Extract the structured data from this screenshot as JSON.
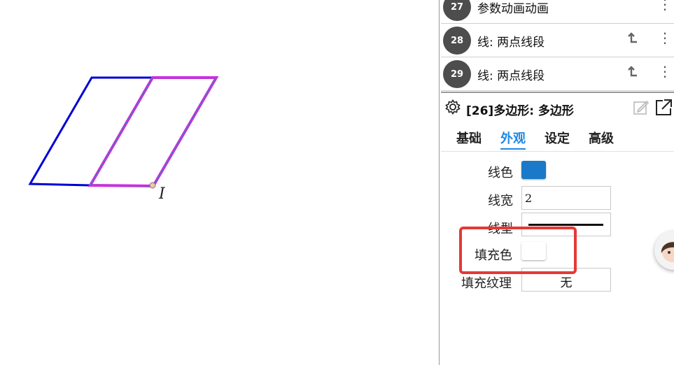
{
  "canvas": {
    "point_label": "I"
  },
  "object_list": [
    {
      "number": "27",
      "label": "参数动画动画",
      "has_redefine": false,
      "more": "⋮"
    },
    {
      "number": "28",
      "label": "线: 两点线段",
      "has_redefine": true,
      "more": "⋮"
    },
    {
      "number": "29",
      "label": "线: 两点线段",
      "has_redefine": true,
      "more": "⋮"
    }
  ],
  "properties": {
    "title": "[26]多边形: 多边形",
    "tabs": [
      "基础",
      "外观",
      "设定",
      "高级"
    ],
    "active_tab": "外观",
    "line_color_label": "线色",
    "line_color": "#1a79c8",
    "line_width_label": "线宽",
    "line_width_value": "2",
    "line_style_label": "线型",
    "fill_color_label": "填充色",
    "fill_color": "#ffffff",
    "fill_texture_label": "填充纹理",
    "fill_texture_value": "无"
  },
  "colors": {
    "polygon_blue": "#0000d6",
    "segment_magenta": "#e020e0",
    "accent": "#1e88e5",
    "highlight": "#e53935",
    "badge": "#4d4d4d"
  },
  "icons": [
    "gear-icon",
    "edit-icon",
    "open-external-icon",
    "redefine-icon",
    "more-icon"
  ]
}
